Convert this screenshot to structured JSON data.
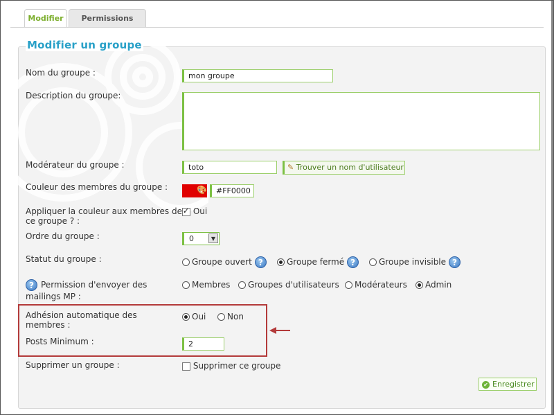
{
  "tabs": [
    {
      "label": "Modifier",
      "active": true
    },
    {
      "label": "Permissions",
      "active": false
    }
  ],
  "form": {
    "legend": "Modifier un groupe",
    "group_name": {
      "label": "Nom du groupe :",
      "value": "mon groupe"
    },
    "description": {
      "label": "Description du groupe:",
      "value": ""
    },
    "moderator": {
      "label": "Modérateur du groupe :",
      "value": "toto",
      "find_button": "Trouver un nom d'utilisateur"
    },
    "color": {
      "label": "Couleur des membres du groupe :",
      "value": "#FF0000",
      "swatch_color": "#e00000"
    },
    "apply_color": {
      "label_line1": "Appliquer la couleur aux membres de",
      "label_line2": "ce groupe ? :",
      "option": "Oui",
      "checked": true
    },
    "order": {
      "label": "Ordre du groupe :",
      "value": "0"
    },
    "status": {
      "label": "Statut du groupe :",
      "options": [
        "Groupe ouvert",
        "Groupe fermé",
        "Groupe invisible"
      ],
      "selected": "Groupe fermé"
    },
    "mailing": {
      "label_line1": "Permission d'envoyer des",
      "label_line2": "mailings MP :",
      "options": [
        "Membres",
        "Groupes d'utilisateurs",
        "Modérateurs",
        "Admin"
      ],
      "selected": "Admin"
    },
    "auto_join": {
      "label_line1": "Adhésion automatique des",
      "label_line2": "membres :",
      "options": [
        "Oui",
        "Non"
      ],
      "selected": "Oui"
    },
    "min_posts": {
      "label": "Posts Minimum :",
      "value": "2"
    },
    "delete": {
      "label": "Supprimer un groupe :",
      "option": "Supprimer ce groupe",
      "checked": false
    },
    "save_label": "Enregistrer"
  },
  "icons": {
    "help": "help-icon",
    "find": "pencil-icon",
    "color_picker": "color-picker-icon",
    "save": "check-circle-icon"
  },
  "colors": {
    "accent_green": "#7cc043",
    "legend_blue": "#2aa1c8",
    "highlight_red": "#b33a3a"
  }
}
